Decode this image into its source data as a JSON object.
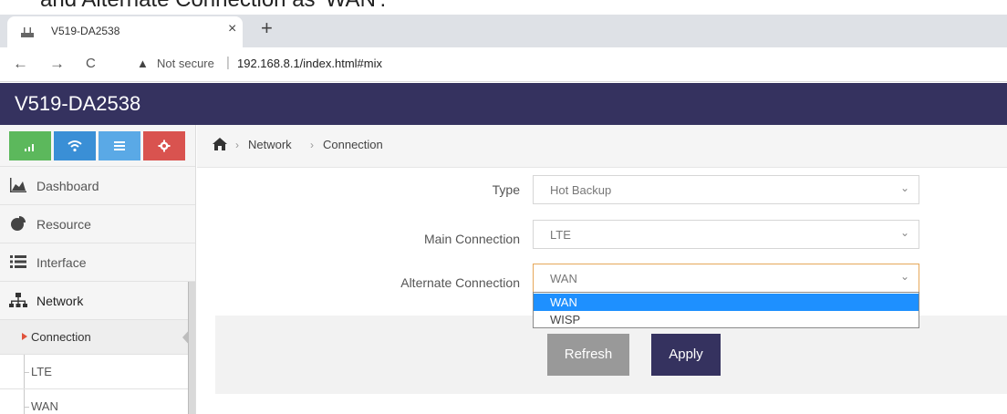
{
  "doc_cut_text": "and Alternate Connection as 'WAN'.",
  "browser": {
    "tab_title": "V519-DA2538",
    "tab_close": "×",
    "new_tab": "+",
    "back": "←",
    "forward": "→",
    "reload": "C",
    "warning": "▲",
    "not_secure": "Not secure",
    "separator": "|",
    "url": "192.168.8.1/index.html#mix"
  },
  "app": {
    "title": "V519-DA2538"
  },
  "quick_buttons": [
    {
      "icon": "signal-icon",
      "color": "#5cb85c"
    },
    {
      "icon": "wifi-icon",
      "color": "#3a8fd6"
    },
    {
      "icon": "list-icon",
      "color": "#5aa9e6"
    },
    {
      "icon": "gear-icon",
      "color": "#d9534f"
    }
  ],
  "sidebar": {
    "items": [
      {
        "label": "Dashboard",
        "icon": "dashboard-icon"
      },
      {
        "label": "Resource",
        "icon": "pie-chart-icon"
      },
      {
        "label": "Interface",
        "icon": "list-icon"
      },
      {
        "label": "Network",
        "icon": "network-icon"
      }
    ],
    "sub_items": [
      {
        "label": "Connection",
        "active": true
      },
      {
        "label": "LTE",
        "active": false
      },
      {
        "label": "WAN",
        "active": false
      }
    ]
  },
  "breadcrumb": {
    "sep": "›",
    "level1": "Network",
    "level2": "Connection"
  },
  "form": {
    "type_label": "Type",
    "type_value": "Hot Backup",
    "main_label": "Main Connection",
    "main_value": "LTE",
    "alt_label": "Alternate Connection",
    "alt_value": "WAN",
    "chevron": "⌄",
    "options": [
      "WAN",
      "WISP"
    ]
  },
  "actions": {
    "refresh": "Refresh",
    "apply": "Apply"
  },
  "colors": {
    "header_bg": "#35325f",
    "apply_bg": "#35325f",
    "refresh_bg": "#999999",
    "selected_option": "#1e90ff",
    "focus_border": "#e6a85a"
  }
}
